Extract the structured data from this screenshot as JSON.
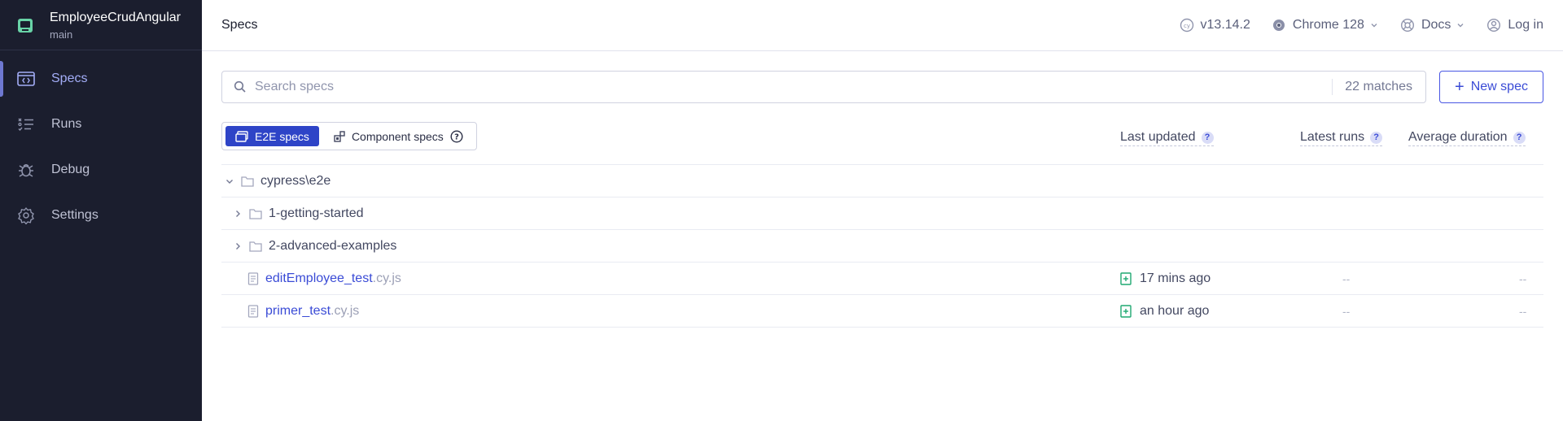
{
  "project": {
    "name": "EmployeeCrudAngular",
    "branch": "main"
  },
  "sidebar": {
    "items": [
      {
        "label": "Specs",
        "icon": "specs-icon",
        "active": true
      },
      {
        "label": "Runs",
        "icon": "runs-icon",
        "active": false
      },
      {
        "label": "Debug",
        "icon": "debug-icon",
        "active": false
      },
      {
        "label": "Settings",
        "icon": "gear-icon",
        "active": false
      }
    ]
  },
  "header": {
    "title": "Specs",
    "version": "v13.14.2",
    "browser": "Chrome 128",
    "docs": "Docs",
    "login": "Log in"
  },
  "search": {
    "placeholder": "Search specs",
    "value": "",
    "matches": "22 matches"
  },
  "new_spec_label": "New spec",
  "tabs": {
    "e2e": "E2E specs",
    "component": "Component specs"
  },
  "columns": {
    "last_updated": "Last updated",
    "latest_runs": "Latest runs",
    "average_duration": "Average duration"
  },
  "tree": {
    "root": "cypress\\e2e",
    "folders": [
      "1-getting-started",
      "2-advanced-examples"
    ],
    "specs": [
      {
        "name": "editEmployee_test",
        "ext": ".cy.js",
        "updated": "17 mins ago",
        "runs": "--",
        "duration": "--"
      },
      {
        "name": "primer_test",
        "ext": ".cy.js",
        "updated": "an hour ago",
        "runs": "--",
        "duration": "--"
      }
    ]
  },
  "colors": {
    "sidebar_bg": "#1b1e2e",
    "accent": "#3a4bd6",
    "active_nav": "#a3adf7",
    "added_icon": "#1fa971"
  }
}
